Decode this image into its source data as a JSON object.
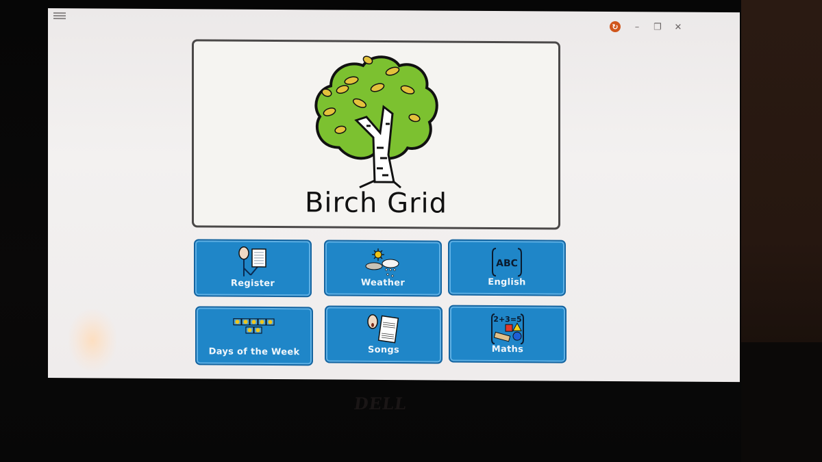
{
  "app": {
    "title": "Birch Grid",
    "menu_icon": "hamburger-menu-icon",
    "window_controls": {
      "sync": "sync-icon",
      "minimize": "–",
      "restore": "❐",
      "close": "✕"
    }
  },
  "hero": {
    "title": "Birch Grid",
    "image": "birch-tree-icon"
  },
  "tiles": [
    {
      "label": "Register",
      "icon": "register-icon"
    },
    {
      "label": "Weather",
      "icon": "weather-icon"
    },
    {
      "label": "English",
      "icon": "english-abc-icon",
      "icon_text": "ABC"
    },
    {
      "label": "Days of the Week",
      "icon": "days-of-week-icon"
    },
    {
      "label": "Songs",
      "icon": "songs-icon"
    },
    {
      "label": "Maths",
      "icon": "maths-icon",
      "icon_text": "2+3=5"
    }
  ],
  "colors": {
    "tile_blue": "#1f86c8",
    "tile_border": "#1464a0",
    "sync_orange": "#d0561c",
    "tree_green": "#7cc130",
    "leaf_yellow": "#e3c23c"
  },
  "monitor": {
    "brand": "DELL"
  }
}
